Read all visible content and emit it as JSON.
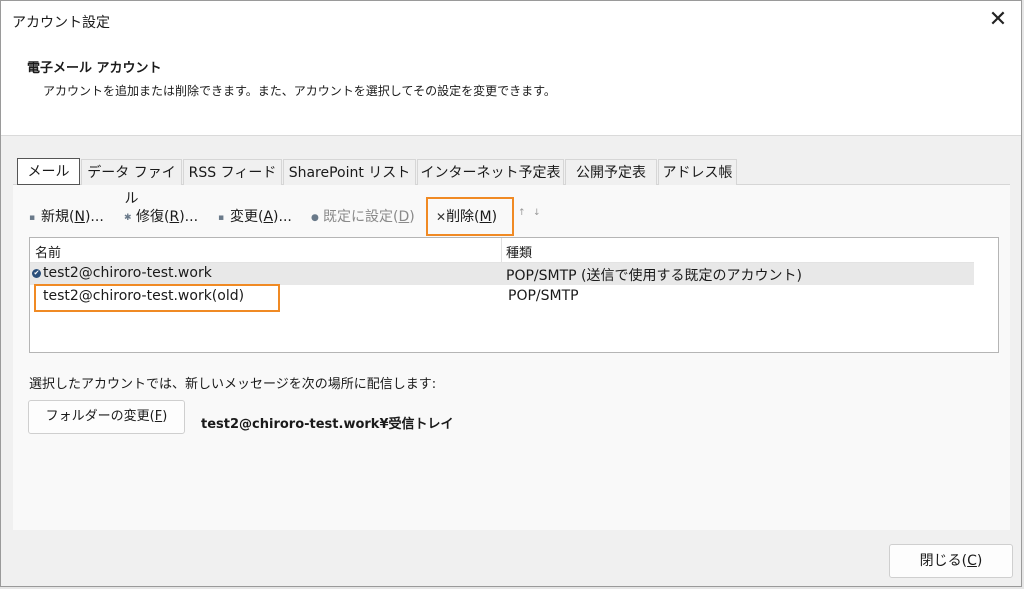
{
  "window": {
    "title": "アカウント設定",
    "close_symbol": "✕"
  },
  "header": {
    "title": "電子メール アカウント",
    "description": "アカウントを追加または削除できます。また、アカウントを選択してその設定を変更できます。"
  },
  "tabs": [
    {
      "label": "メール",
      "active": true
    },
    {
      "label": "データ ファイル"
    },
    {
      "label": "RSS フィード"
    },
    {
      "label": "SharePoint リスト"
    },
    {
      "label": "インターネット予定表"
    },
    {
      "label": "公開予定表"
    },
    {
      "label": "アドレス帳"
    }
  ],
  "toolbar": {
    "new": {
      "text": "新規(",
      "key": "N",
      "suffix": ")...",
      "icon": "new-account-icon"
    },
    "repair": {
      "text": "修復(",
      "key": "R",
      "suffix": ")...",
      "icon": "repair-icon"
    },
    "change": {
      "text": "変更(",
      "key": "A",
      "suffix": ")...",
      "icon": "change-icon"
    },
    "set_default": {
      "text": "既定に設定(",
      "key": "D",
      "suffix": ")",
      "icon": "default-icon"
    },
    "delete": {
      "text": "削除(",
      "key": "M",
      "suffix": ")",
      "icon": "delete-icon",
      "symbol": "✕"
    },
    "move_up_symbol": "↑",
    "move_down_symbol": "↓"
  },
  "accounts_table": {
    "columns": [
      "名前",
      "種類"
    ],
    "rows": [
      {
        "name": "test2@chiroro-test.work",
        "type": "POP/SMTP (送信で使用する既定のアカウント)",
        "default": true,
        "selected": true
      },
      {
        "name": "test2@chiroro-test.work(old)",
        "type": "POP/SMTP",
        "default": false,
        "selected": false
      }
    ]
  },
  "delivery": {
    "label": "選択したアカウントでは、新しいメッセージを次の場所に配信します:",
    "change_folder": {
      "text": "フォルダーの変更(",
      "key": "F",
      "suffix": ")"
    },
    "folder_path": "test2@chiroro-test.work¥受信トレイ"
  },
  "close_button": {
    "text": "閉じる(",
    "key": "C",
    "suffix": ")"
  },
  "colors": {
    "highlight": "#f08a24",
    "selected_row": "#e8e8e8"
  }
}
